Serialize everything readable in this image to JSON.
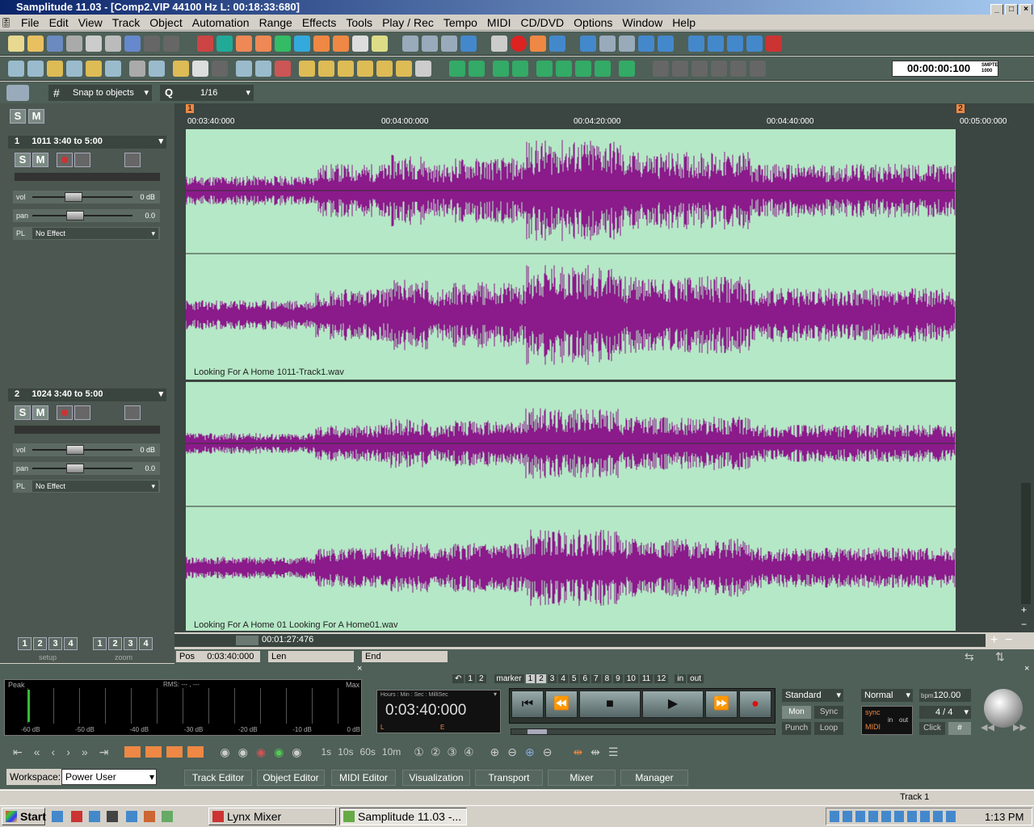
{
  "window": {
    "title": "Samplitude 11.03 - [Comp2.VIP   44100 Hz L: 00:18:33:680]"
  },
  "menu": [
    "File",
    "Edit",
    "View",
    "Track",
    "Object",
    "Automation",
    "Range",
    "Effects",
    "Tools",
    "Play / Rec",
    "Tempo",
    "MIDI",
    "CD/DVD",
    "Options",
    "Window",
    "Help"
  ],
  "toolbar": {
    "snap_label": "Snap to objects",
    "quant_value": "1/16",
    "time_display": "00:00:00:100",
    "smpte_label": "SMPTE 1000"
  },
  "left_panel": {
    "solo": "S",
    "mute": "M"
  },
  "tracks": [
    {
      "num": "1",
      "name": "1011 3:40 to 5:00",
      "vol_label": "vol",
      "vol_val": "0 dB",
      "pan_label": "pan",
      "pan_val": "0.0",
      "pl_label": "PL",
      "effect": "No Effect",
      "clip_label": "Looking For A Home  1011-Track1.wav"
    },
    {
      "num": "2",
      "name": "1024 3:40 to 5:00",
      "vol_label": "vol",
      "vol_val": "0 dB",
      "pan_label": "pan",
      "pan_val": "0.0",
      "pl_label": "PL",
      "effect": "No Effect",
      "clip_label": "Looking For A Home  01 Looking For A Home01.wav"
    }
  ],
  "ruler": {
    "marker1": "1",
    "marker2": "2",
    "ticks": [
      "00:03:40:000",
      "00:04:00:000",
      "00:04:20:000",
      "00:04:40:000",
      "00:05:00:000"
    ]
  },
  "setup": {
    "label": "setup",
    "buttons": [
      "1",
      "2",
      "3",
      "4"
    ]
  },
  "zoom": {
    "label": "zoom",
    "buttons": [
      "1",
      "2",
      "3",
      "4"
    ]
  },
  "scroll_time": "00:01:27:476",
  "pos_fields": {
    "pos_label": "Pos",
    "pos_value": "0:03:40:000",
    "len_label": "Len",
    "end_label": "End"
  },
  "meter": {
    "peak_label": "Peak",
    "rms_label": "RMS: --- , ---",
    "max_label": "Max",
    "db_scale": [
      "-60 dB",
      "-50 dB",
      "-40 dB",
      "-30 dB",
      "-20 dB",
      "-10 dB",
      "0 dB"
    ]
  },
  "transport": {
    "marker_label": "marker",
    "marker_nums": [
      "1",
      "2",
      "3",
      "4",
      "5",
      "6",
      "7",
      "8",
      "9",
      "10",
      "11",
      "12"
    ],
    "in_label": "in",
    "out_label": "out",
    "time_format": "Hours : Min : Sec : MilliSec",
    "time_value": "0:03:40:000",
    "l_label": "L",
    "e_label": "E",
    "mode_select": "Standard",
    "mon": "Mon",
    "sync": "Sync",
    "punch": "Punch",
    "loop": "Loop",
    "normal_select": "Normal",
    "bpm_label": "bpm",
    "bpm_value": "120.00",
    "meter_sig": "4 / 4",
    "sync_label": "sync",
    "midi_label": "MIDI",
    "in": "in",
    "out": "out",
    "click": "Click"
  },
  "lower_toolbar": {
    "zoom_steps": [
      "1s",
      "10s",
      "60s",
      "10m"
    ]
  },
  "workspace": {
    "label": "Workspace:",
    "value": "Power User",
    "buttons": [
      "Track Editor",
      "Object Editor",
      "MIDI Editor",
      "Visualization",
      "Transport",
      "Mixer",
      "Manager"
    ]
  },
  "statusbar": {
    "track": "Track 1"
  },
  "taskbar": {
    "start": "Start",
    "tasks": [
      "Lynx Mixer",
      "Samplitude 11.03 -..."
    ],
    "clock": "1:13 PM"
  },
  "colors": {
    "waveform": "#8b1a8b",
    "lane_bg": "#b5e8c6",
    "panel": "#4b5750"
  }
}
